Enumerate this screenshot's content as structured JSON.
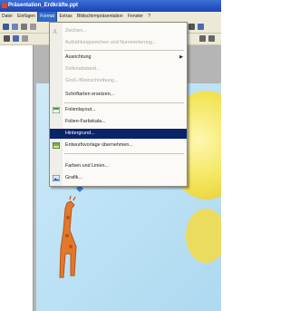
{
  "window": {
    "title": "Präsentation_Erdkräfte.ppt"
  },
  "menubar": [
    "Datei",
    "Einfügen",
    "Format",
    "Extras",
    "Bildschirmpräsentation",
    "Fenster",
    "?"
  ],
  "active_menu": "Format",
  "format_menu": {
    "items": [
      {
        "label": "Zeichen...",
        "disabled": true,
        "icon": "font-icon"
      },
      {
        "label": "Aufzählungszeichen und Nummerierung...",
        "disabled": true
      },
      {
        "label": "Ausrichtung",
        "disabled": false,
        "submenu": true
      },
      {
        "label": "Zeilenabstand...",
        "disabled": true
      },
      {
        "label": "Groß-/Kleinschreibung...",
        "disabled": true
      },
      {
        "label": "Schriftarten ersetzen...",
        "disabled": false
      },
      {
        "label": "Folienlayout...",
        "disabled": false,
        "icon": "slide-layout-icon"
      },
      {
        "label": "Folien-Farbskala...",
        "disabled": false
      },
      {
        "label": "Hintergrund...",
        "disabled": false,
        "selected": true
      },
      {
        "label": "Entwurfsvorlage übernehmen...",
        "disabled": false,
        "icon": "design-template-icon"
      },
      {
        "label": "Farben und Linien...",
        "disabled": false
      },
      {
        "label": "Grafik...",
        "disabled": false,
        "icon": "picture-icon"
      }
    ]
  },
  "colors": {
    "selection": "#0a246a",
    "menubar_active": "#316ac5",
    "title_bar": "#1c43b8",
    "slide_background": "#bfe3f6",
    "sun": "#f3e55a",
    "giraffe": "#e4782a"
  }
}
